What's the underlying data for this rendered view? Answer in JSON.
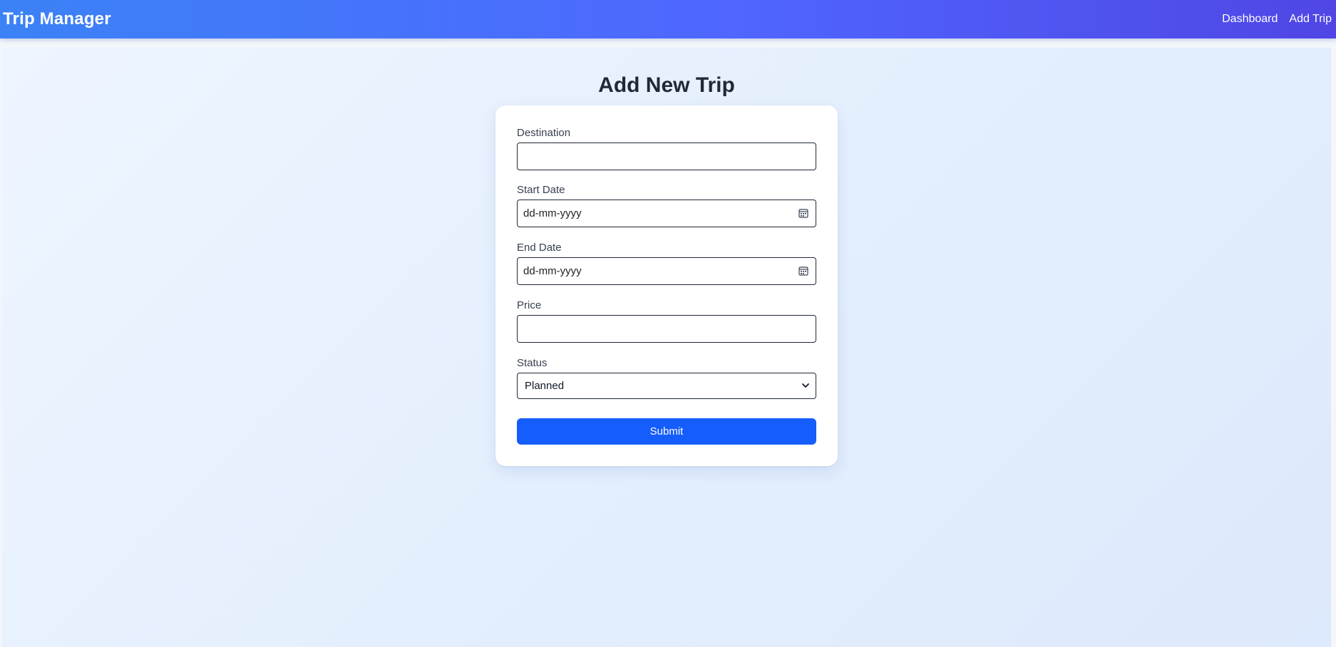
{
  "app": {
    "title": "Trip Manager"
  },
  "nav": {
    "links": [
      {
        "label": "Dashboard"
      },
      {
        "label": "Add Trip"
      }
    ]
  },
  "page": {
    "title": "Add New Trip"
  },
  "form": {
    "destination": {
      "label": "Destination",
      "value": ""
    },
    "start_date": {
      "label": "Start Date",
      "placeholder": "dd-mm-yyyy"
    },
    "end_date": {
      "label": "End Date",
      "placeholder": "dd-mm-yyyy"
    },
    "price": {
      "label": "Price",
      "value": ""
    },
    "status": {
      "label": "Status",
      "selected": "Planned"
    },
    "submit_label": "Submit"
  },
  "colors": {
    "navbar_start": "#3b82f6",
    "navbar_end": "#4f46e5",
    "submit_button": "#155dfc",
    "page_background": "#e4effd"
  },
  "icons": {
    "date_picker": "calendar-icon",
    "select_arrow": "chevron-down-icon"
  }
}
